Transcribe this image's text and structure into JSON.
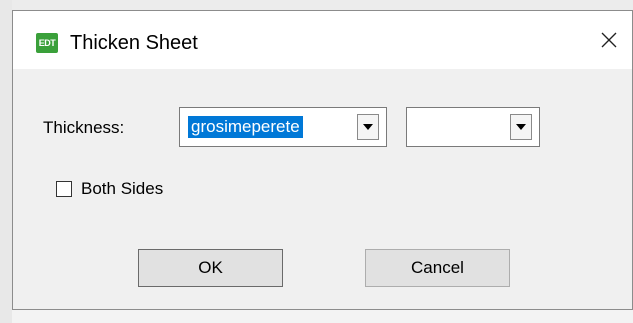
{
  "dialog": {
    "title": "Thicken Sheet",
    "app_icon_text": "EDT",
    "close_glyph": "×"
  },
  "thickness": {
    "label": "Thickness:",
    "value": "grosimeperete",
    "unit_value": ""
  },
  "both_sides": {
    "label": "Both Sides",
    "checked": false
  },
  "buttons": {
    "ok": "OK",
    "cancel": "Cancel"
  },
  "colors": {
    "selection": "#0078d7",
    "app_icon": "#3aa03a"
  }
}
